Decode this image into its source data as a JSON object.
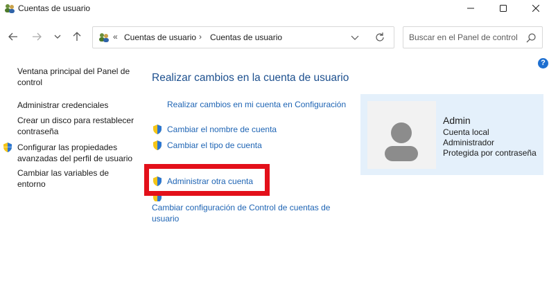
{
  "window": {
    "title": "Cuentas de usuario",
    "minimize_icon": "minimize-icon",
    "maximize_icon": "maximize-icon",
    "close_icon": "close-icon"
  },
  "address": {
    "crumbs": [
      "Cuentas de usuario",
      "Cuentas de usuario"
    ],
    "prefix_glyph": "«",
    "separator_glyph": "›"
  },
  "search": {
    "placeholder": "Buscar en el Panel de control"
  },
  "left_nav": {
    "items": [
      {
        "label": "Ventana principal del Panel de control",
        "shield": false
      },
      {
        "label": "Administrar credenciales",
        "shield": false
      },
      {
        "label": "Crear un disco para restablecer contraseña",
        "shield": false
      },
      {
        "label": "Configurar las propiedades avanzadas del perfil de usuario",
        "shield": true
      },
      {
        "label": "Cambiar las variables de entorno",
        "shield": false
      }
    ]
  },
  "main": {
    "heading": "Realizar cambios en la cuenta de usuario",
    "links": [
      {
        "label": "Realizar cambios en mi cuenta en Configuración",
        "shield": false
      },
      {
        "label": "Cambiar el nombre de cuenta",
        "shield": true
      },
      {
        "label": "Cambiar el tipo de cuenta",
        "shield": true
      },
      {
        "label": "Administrar otra cuenta",
        "shield": true
      },
      {
        "label": "Cambiar configuración de Control de cuentas de usuario",
        "shield": true
      }
    ]
  },
  "account": {
    "name": "Admin",
    "details": [
      "Cuenta local",
      "Administrador",
      "Protegida por contraseña"
    ]
  },
  "colors": {
    "link": "#1e64b4",
    "heading": "#1c4f8e",
    "card_bg": "#e4f0fb",
    "highlight": "#e3101a"
  }
}
